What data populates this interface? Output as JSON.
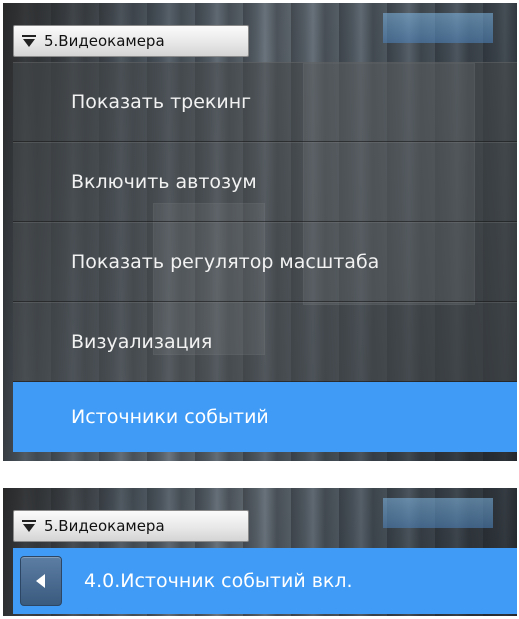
{
  "top_panel": {
    "camera_label": "5.Видеокамера",
    "menu_items": [
      {
        "label": "Показать трекинг"
      },
      {
        "label": "Включить автозум"
      },
      {
        "label": "Показать регулятор масштаба"
      },
      {
        "label": "Визуализация"
      },
      {
        "label": "Источники событий",
        "selected": true
      }
    ]
  },
  "bottom_panel": {
    "camera_label": "5.Видеокамера",
    "submenu_title": "4.0.Источник событий вкл."
  },
  "colors": {
    "selection_blue": "#3f9bf6",
    "back_button": "#4a6b90"
  },
  "icons": [
    "dropdown-arrow-icon",
    "back-arrow-icon"
  ]
}
